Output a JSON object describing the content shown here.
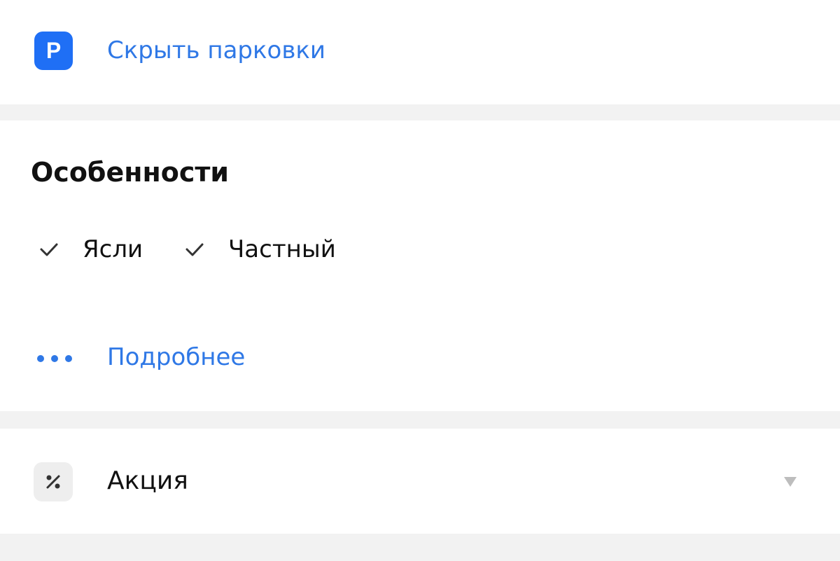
{
  "colors": {
    "accent": "#2f78e6",
    "parking_icon_bg": "#1f6ff5",
    "page_bg": "#f2f2f2",
    "card_bg": "#ffffff",
    "text": "#111111",
    "muted_icon": "#bdbdbd"
  },
  "parking": {
    "icon": "parking-icon",
    "icon_letter": "P",
    "label": "Скрыть парковки"
  },
  "features": {
    "title": "Особенности",
    "items": [
      {
        "icon": "check-icon",
        "label": "Ясли"
      },
      {
        "icon": "check-icon",
        "label": "Частный"
      }
    ],
    "more": {
      "icon": "more-dots-icon",
      "label": "Подробнее"
    }
  },
  "promo": {
    "icon": "percent-icon",
    "label": "Акция",
    "expand_icon": "chevron-down-icon"
  }
}
